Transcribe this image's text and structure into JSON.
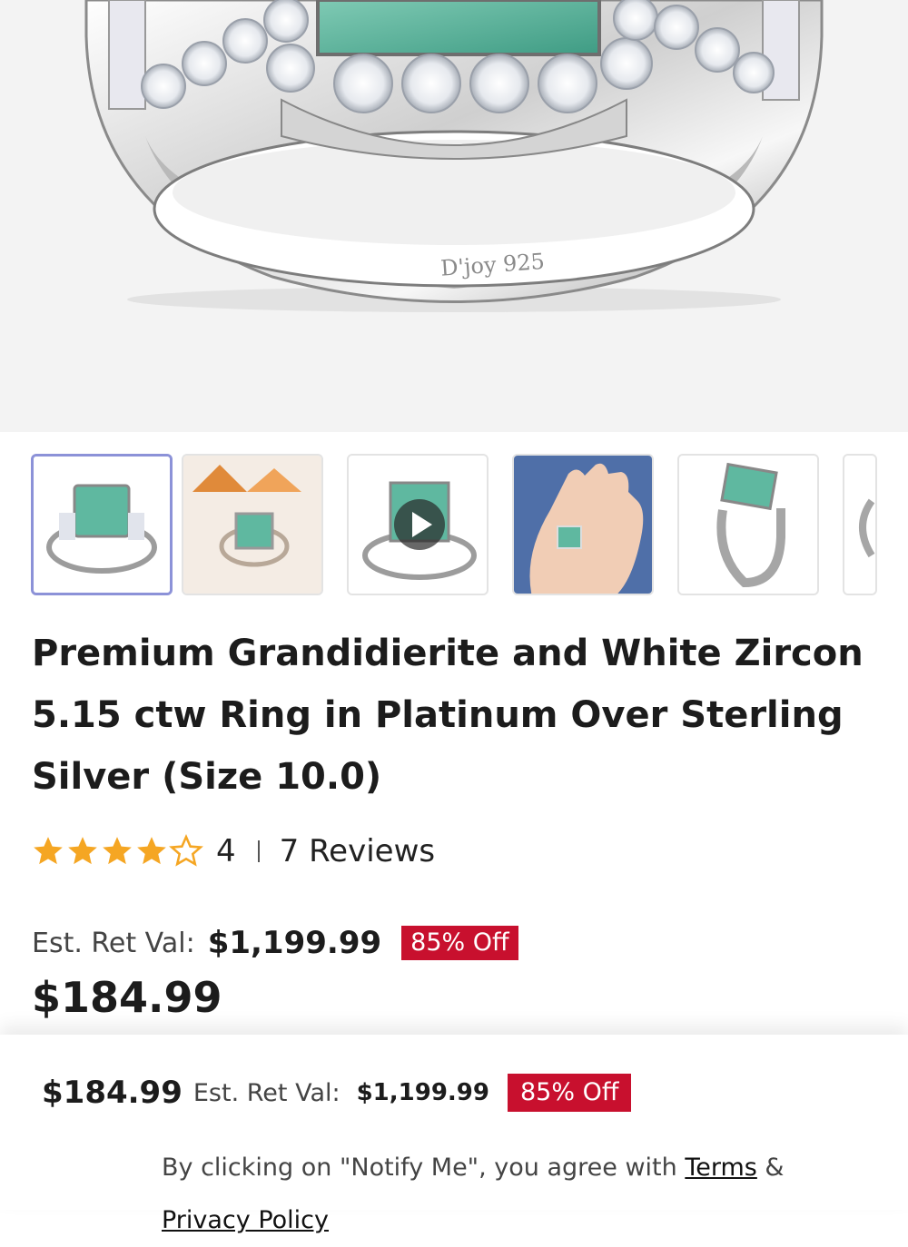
{
  "hero": {
    "engraving": "D'joy 925"
  },
  "thumbnails": [
    {
      "label": "ring-front",
      "active": true
    },
    {
      "label": "ring-lifestyle",
      "active": false
    },
    {
      "label": "ring-video",
      "active": false
    },
    {
      "label": "ring-on-hand",
      "active": false
    },
    {
      "label": "ring-side",
      "active": false
    },
    {
      "label": "ring-partial",
      "active": false
    }
  ],
  "product": {
    "title": "Premium Grandidierite and White Zircon 5.15 ctw Ring in Platinum Over Sterling Silver (Size 10.0)",
    "rating": "4",
    "rating_value": 4,
    "rating_max": 5,
    "reviews": "7 Reviews",
    "est_label": "Est. Ret Val:",
    "est_value": "$1,199.99",
    "discount": "85% Off",
    "price": "$184.99"
  },
  "sticky": {
    "price": "$184.99",
    "est_label": "Est. Ret Val:",
    "est_value": "$1,199.99",
    "discount": "85% Off",
    "notice_prefix": "By clicking on \"Notify Me\", you agree with ",
    "terms": "Terms",
    "and": " & ",
    "privacy": "Privacy Policy"
  },
  "colors": {
    "star": "#f5a623",
    "discount_bg": "#c8102e",
    "active_thumb_border": "#8c92d8",
    "gem": "#5fb8a0"
  },
  "icons": {
    "star": "star-icon",
    "play": "play-icon"
  }
}
